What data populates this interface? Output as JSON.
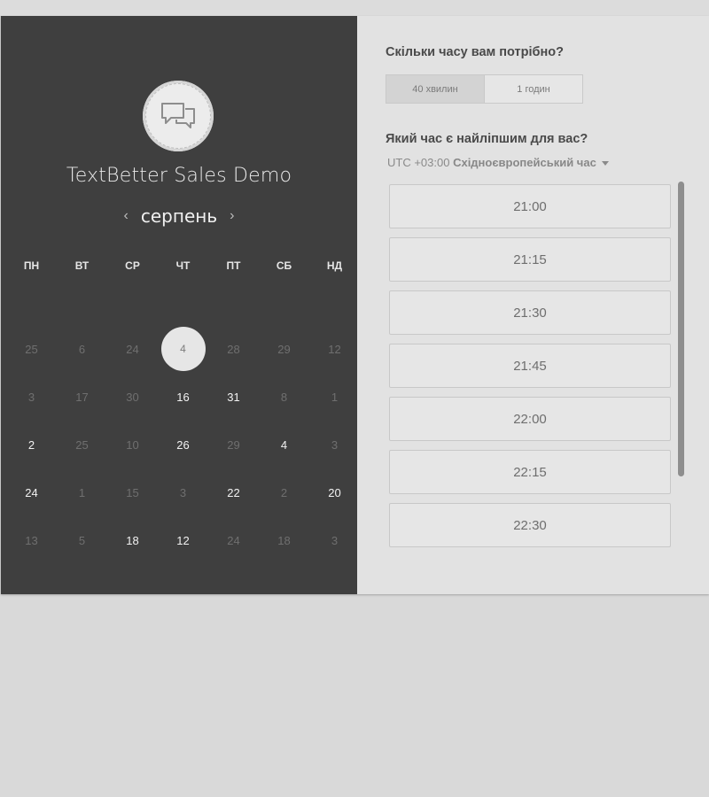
{
  "sidebar": {
    "title": "TextBetter Sales Demo",
    "month": "серпень",
    "prev_icon": "‹",
    "next_icon": "›",
    "weekdays": [
      "ПН",
      "ВТ",
      "СР",
      "ЧТ",
      "ПТ",
      "СБ",
      "НД"
    ],
    "days": [
      [
        "25",
        "6",
        "24",
        "4",
        "28",
        "29",
        "12"
      ],
      [
        "3",
        "17",
        "30",
        "16",
        "31",
        "8",
        "1"
      ],
      [
        "2",
        "25",
        "10",
        "26",
        "29",
        "4",
        "3"
      ],
      [
        "24",
        "1",
        "15",
        "3",
        "22",
        "2",
        "20"
      ],
      [
        "13",
        "5",
        "18",
        "12",
        "24",
        "18",
        "3"
      ]
    ],
    "selected_day": "4"
  },
  "scheduler": {
    "duration_question": "Скільки часу вам потрібно?",
    "duration_options": [
      "40 хвилин",
      "1 годин"
    ],
    "duration_selected": "40 хвилин",
    "time_question": "Який час є найліпшим для вас?",
    "timezone_offset": "UTC +03:00",
    "timezone_name": "Східноєвропейський час",
    "slots": [
      "21:00",
      "21:15",
      "21:30",
      "21:45",
      "22:00",
      "22:15",
      "22:30",
      ""
    ]
  }
}
